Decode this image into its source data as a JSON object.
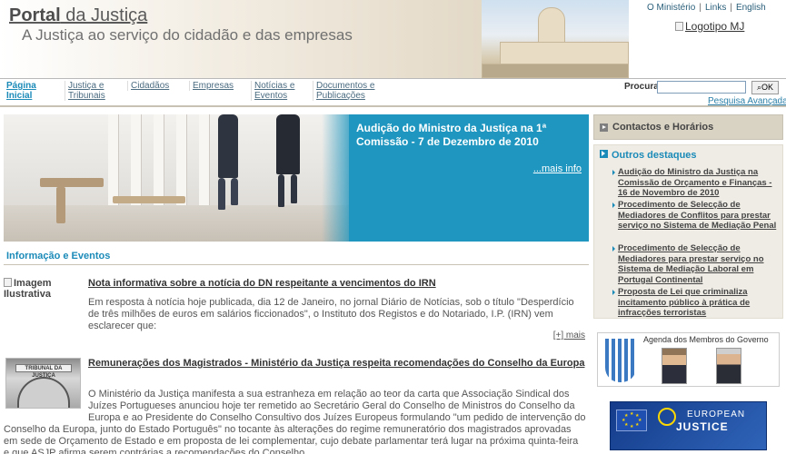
{
  "header": {
    "title_bold": "Portal",
    "title_rest": " da Justiça",
    "subtitle": "A Justiça ao serviço do cidadão e das empresas",
    "top_links": [
      "O Ministério",
      "Links",
      "English"
    ],
    "logo_alt": "Logotipo MJ"
  },
  "nav": {
    "items": [
      "Página Inicial",
      "Justiça e Tribunais",
      "Cidadãos",
      "Empresas",
      "Notícias e Eventos",
      "Documentos e Publicações"
    ],
    "search_label": "Procura",
    "search_button": "OK",
    "advanced_search": "Pesquisa Avançada"
  },
  "banner": {
    "title": "Audição do Ministro da Justiça na 1ª Comissão - 7 de Dezembro de 2010",
    "more": "...mais info"
  },
  "section": {
    "title": "Informação e Eventos"
  },
  "news": [
    {
      "image_alt": "Imagem Ilustrativa",
      "title": "Nota informativa sobre a notícia do DN respeitante a vencimentos do IRN",
      "body": "Em resposta à notícia hoje publicada, dia 12 de Janeiro, no jornal Diário de Notícias, sob o título \"Desperdício de três milhões de euros em salários ficcionados\", o Instituto dos Registos e do Notariado, I.P. (IRN) vem esclarecer que:",
      "more": "[+] mais"
    },
    {
      "thumb_plate": "TRIBUNAL DA JUSTIÇA",
      "title": "Remunerações dos Magistrados - Ministério da Justiça respeita recomendações do Conselho da Europa",
      "body_a": "O Ministério da Justiça manifesta a sua estranheza em relação ao teor da carta que Associação Sindical dos Juízes Portugueses anunciou hoje ter remetido ao Secretário Geral do Conselho de Ministros do Conselho da Europa e ao Presidente do Conselho Consultivo dos Juízes Europeus formulando \"um pedido de intervenção do",
      "body_b": "Conselho da Europa, junto do Estado Português\" no tocante às alterações do regime remuneratório dos magistrados aprovadas em sede de Orçamento de Estado e em proposta de lei complementar, cujo debate parlamentar terá lugar na próxima quinta-feira e que ASJP afirma serem contrárias a recomendações do Conselho."
    }
  ],
  "right": {
    "contacts": "Contactos e Horários",
    "highlights_title": "Outros destaques",
    "highlights": [
      "Audição do Ministro da Justiça na Comissão de Orçamento e Finanças - 16 de Novembro de 2010",
      "Procedimento de Selecção de Mediadores de Conflitos para prestar serviço no Sistema de Mediação Penal",
      "Procedimento de Selecção de Mediadores para prestar serviço no Sistema de Mediação Laboral em Portugal Continental",
      "Proposta de Lei que criminaliza incitamento público à prática de infracções terroristas"
    ],
    "agenda_label": "Agenda dos Membros do Governo",
    "eu_line1": "EUROPEAN",
    "eu_line2": "JUSTICE"
  },
  "colors": {
    "accent": "#1a8ab8",
    "banner_panel": "#1e96bf",
    "sidebar_box": "#d9d3c4"
  }
}
